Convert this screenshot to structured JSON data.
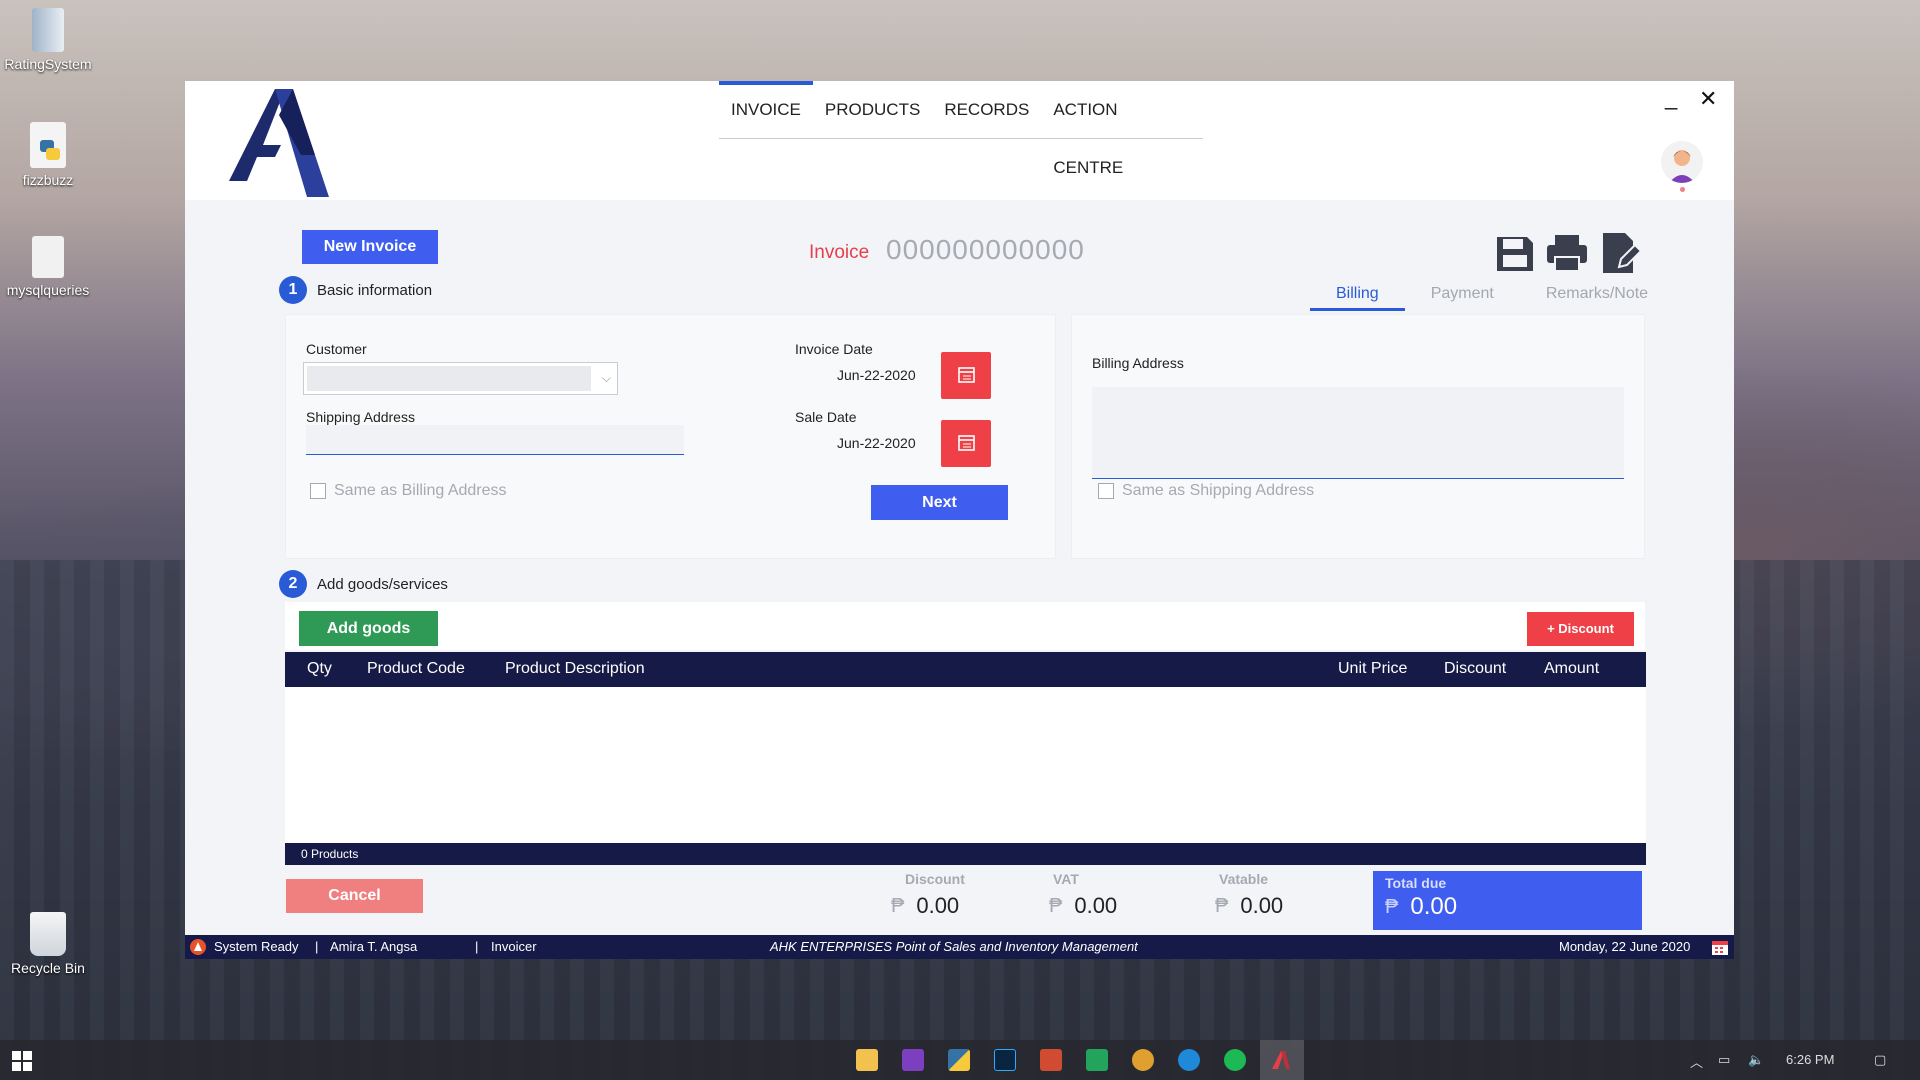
{
  "desktop": {
    "icons": [
      {
        "label": "RatingSystem"
      },
      {
        "label": "fizzbuzz"
      },
      {
        "label": "mysqlqueries"
      },
      {
        "label": "Recycle Bin"
      }
    ]
  },
  "window": {
    "nav": [
      {
        "label": "INVOICE",
        "active": true
      },
      {
        "label": "PRODUCTS",
        "active": false
      },
      {
        "label": "RECORDS",
        "active": false
      },
      {
        "label": "ACTION CENTRE",
        "active": false
      }
    ],
    "minimize_glyph": "_",
    "close_glyph": "✕",
    "new_invoice_label": "New Invoice",
    "invoice_label": "Invoice",
    "invoice_number": "000000000000",
    "step1": {
      "number": "1",
      "label": "Basic information"
    },
    "step2": {
      "number": "2",
      "label": "Add goods/services"
    },
    "right_tabs": [
      {
        "label": "Billing",
        "active": true
      },
      {
        "label": "Payment",
        "active": false
      },
      {
        "label": "Remarks/Note",
        "active": false
      }
    ],
    "customer_label": "Customer",
    "customer_value": "",
    "shipping_address_label": "Shipping Address",
    "shipping_address_value": "",
    "same_as_billing_label": "Same as Billing Address",
    "invoice_date_label": "Invoice Date",
    "invoice_date_value": "Jun-22-2020",
    "sale_date_label": "Sale Date",
    "sale_date_value": "Jun-22-2020",
    "next_label": "Next",
    "billing_address_label": "Billing Address",
    "billing_address_value": "",
    "same_as_shipping_label": "Same as Shipping Address",
    "add_goods_label": "Add goods",
    "discount_btn_label": "+ Discount",
    "table_columns": [
      "Qty",
      "Product Code",
      "Product Description",
      "Unit Price",
      "Discount",
      "Amount"
    ],
    "table_rows": [],
    "products_count_label": "0 Products",
    "cancel_label": "Cancel",
    "currency_symbol": "₱",
    "summary": {
      "discount": {
        "label": "Discount",
        "value": "0.00"
      },
      "vat": {
        "label": "VAT",
        "value": "0.00"
      },
      "vatable": {
        "label": "Vatable",
        "value": "0.00"
      },
      "total_due": {
        "label": "Total due",
        "value": "0.00"
      }
    },
    "status": {
      "state": "System Ready",
      "sep": "|",
      "user": "Amira T. Angsa",
      "role": "Invoicer",
      "app_name": "AHK ENTERPRISES Point of Sales and Inventory Management",
      "date": "Monday, 22 June 2020"
    }
  },
  "taskbar": {
    "clock": "6:26 PM"
  },
  "colors": {
    "accent": "#3f5ef0",
    "nav_dark": "#161a46",
    "danger": "#ef3f47",
    "success": "#2f9a56"
  }
}
